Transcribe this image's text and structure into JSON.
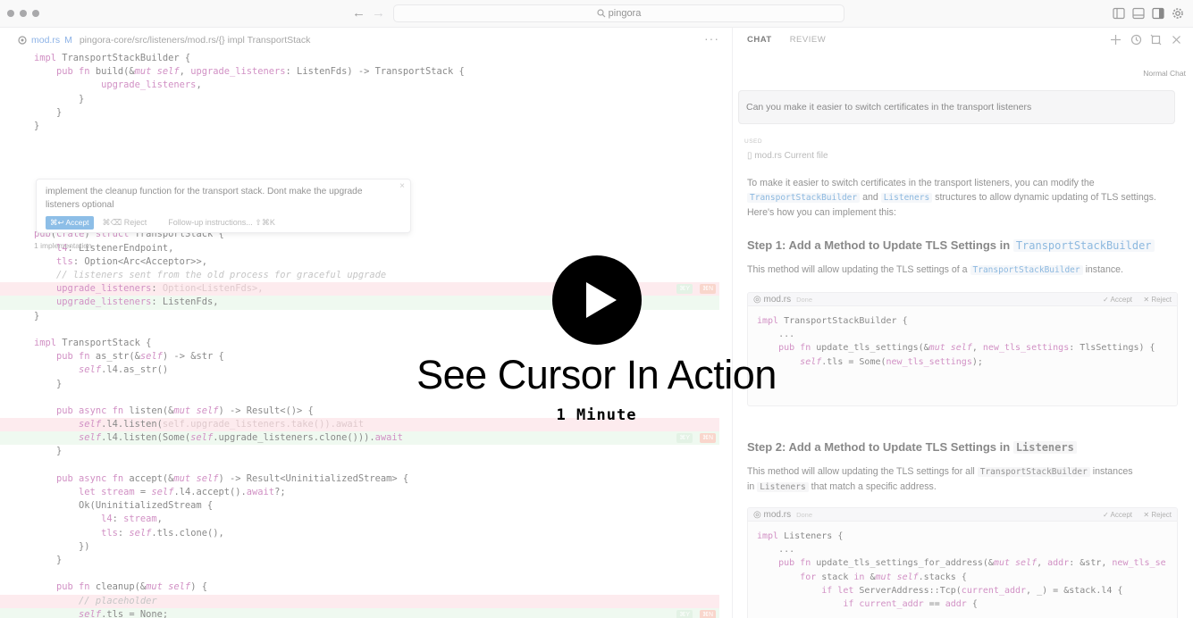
{
  "window": {
    "search": "pingora"
  },
  "editor": {
    "tab_file": "mod.rs",
    "tab_mod": "M",
    "breadcrumb": "pingora-core/src/listeners/mod.rs/",
    "breadcrumb_symbol": "{} impl TransportStack",
    "more": "···",
    "popup": {
      "text": "implement the cleanup function for the transport stack. Dont make the upgrade listeners optional",
      "accept": "⌘↩ Accept",
      "reject": "⌘⌫ Reject",
      "followup": "Follow-up instructions... ⇧⌘K",
      "close": "×"
    },
    "impl_note": "1 implementation",
    "badge_k": "⌘N",
    "badge_y": "⌘Y"
  },
  "chat": {
    "tab_chat": "CHAT",
    "tab_review": "REVIEW",
    "mode": "Normal Chat",
    "user_message": "Can you make it easier to switch certificates in the transport listeners",
    "used_label": "USED",
    "used_file": "mod.rs Current file",
    "intro_1": "To make it easier to switch certificates in the transport listeners, you can modify the",
    "intro_chip1": "TransportStackBuilder",
    "intro_and": "and",
    "intro_chip2": "Listeners",
    "intro_2": "structures to allow dynamic updating of TLS settings.",
    "intro_3": "Here's how you can implement this:",
    "step1_title": "Step 1: Add a Method to Update TLS Settings in",
    "step1_chip": "TransportStackBuilder",
    "step1_desc": "This method will allow updating the TLS settings of a",
    "step1_desc_chip": "TransportStackBuilder",
    "step1_desc_end": "instance.",
    "step2_title": "Step 2: Add a Method to Update TLS Settings in",
    "step2_chip": "Listeners",
    "step2_desc": "This method will allow updating the TLS settings for all",
    "step2_desc_chip": "TransportStackBuilder",
    "step2_desc_end": "instances",
    "step2_desc_2": "in",
    "step2_desc_chip2": "Listeners",
    "step2_desc_end2": "that match a specific address.",
    "cb_file": "mod.rs",
    "cb_done": "Done",
    "cb_accept": "✓ Accept",
    "cb_reject": "✕ Reject"
  },
  "overlay": {
    "title": "See Cursor In Action",
    "subtitle": "1 Minute"
  }
}
